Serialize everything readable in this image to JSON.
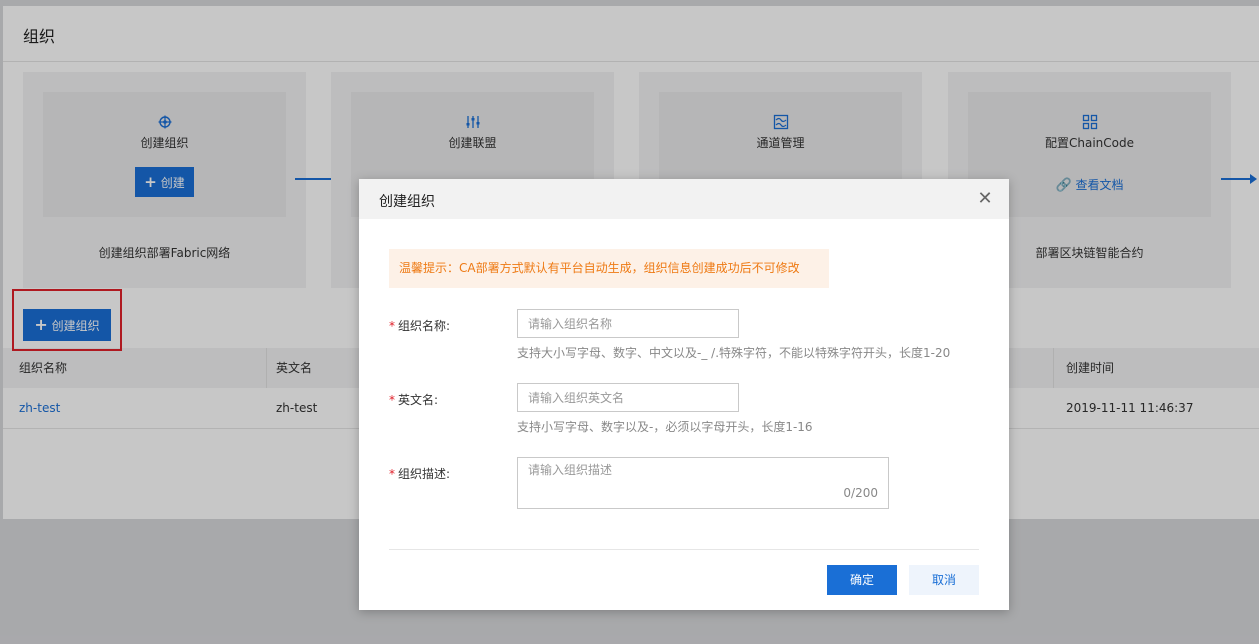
{
  "page": {
    "title": "组织"
  },
  "steps": [
    {
      "title": "创建组织",
      "action": "创建",
      "action_type": "button",
      "desc": "创建组织部署Fabric网络",
      "icon": "helm-icon"
    },
    {
      "title": "创建联盟",
      "action": "",
      "action_type": "hidden",
      "desc": "",
      "icon": "sliders-icon"
    },
    {
      "title": "通道管理",
      "action": "",
      "action_type": "hidden",
      "desc": "",
      "icon": "channel-icon"
    },
    {
      "title": "配置ChainCode",
      "action": "查看文档",
      "action_type": "link",
      "desc": "部署区块链智能合约",
      "icon": "grid-nodes-icon"
    }
  ],
  "toolbar": {
    "create_label": "创建组织"
  },
  "table": {
    "headers": [
      "组织名称",
      "英文名",
      "创建时间"
    ],
    "rows": [
      {
        "name": "zh-test",
        "en_name": "zh-test",
        "created": "2019-11-11 11:46:37"
      }
    ]
  },
  "modal": {
    "title": "创建组织",
    "tip": "温馨提示：CA部署方式默认有平台自动生成，组织信息创建成功后不可修改",
    "fields": {
      "name": {
        "label": "组织名称:",
        "placeholder": "请输入组织名称",
        "hint": "支持大小写字母、数字、中文以及-_ /.特殊字符，不能以特殊字符开头，长度1-20"
      },
      "en_name": {
        "label": "英文名:",
        "placeholder": "请输入组织英文名",
        "hint": "支持小写字母、数字以及-，必须以字母开头，长度1-16"
      },
      "desc": {
        "label": "组织描述:",
        "placeholder": "请输入组织描述",
        "counter": "0/200"
      }
    },
    "ok_label": "确定",
    "cancel_label": "取消"
  },
  "colors": {
    "primary": "#1a6fd6",
    "warning_text": "#ee7a14",
    "warning_bg": "#fdf1e7",
    "highlight_border": "#e0202a"
  }
}
